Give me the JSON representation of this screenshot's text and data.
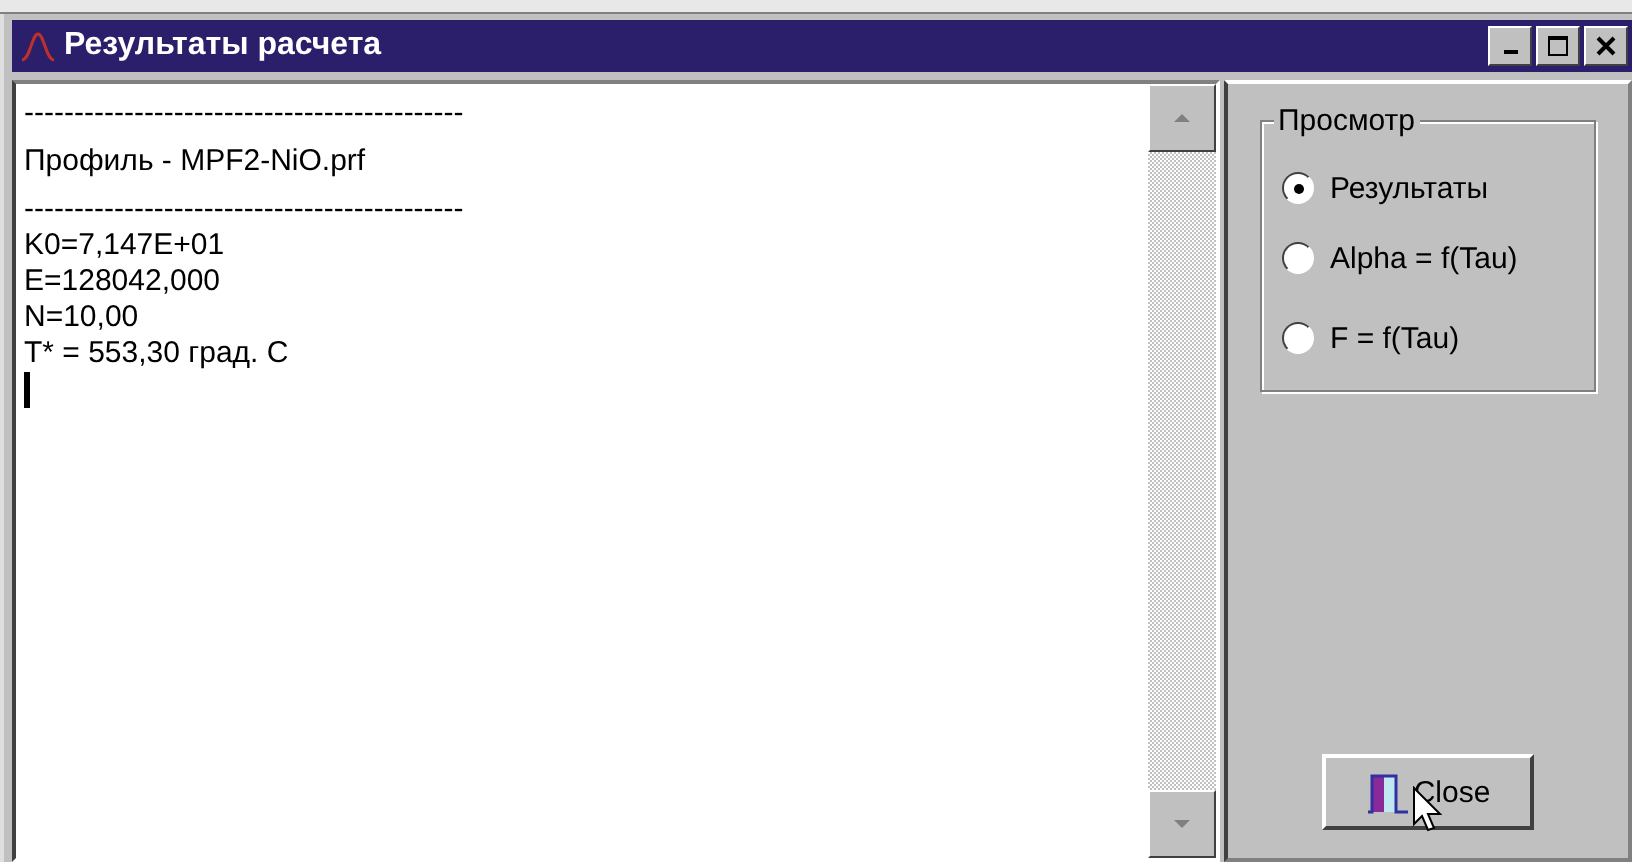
{
  "window": {
    "title": "Результаты расчета"
  },
  "memo": {
    "lines": [
      "--------------------------------------------",
      "Профиль - MPF2-NiO.prf",
      "--------------------------------------------",
      "K0=7,147E+01",
      "E=128042,000",
      "N=10,00",
      "T* = 553,30 град. C"
    ]
  },
  "view_group": {
    "title": "Просмотр",
    "options": [
      {
        "label": "Результаты",
        "selected": true
      },
      {
        "label": "Alpha = f(Tau)",
        "selected": false
      },
      {
        "label": "F = f(Tau)",
        "selected": false
      }
    ]
  },
  "close_button": {
    "label": "Close"
  }
}
